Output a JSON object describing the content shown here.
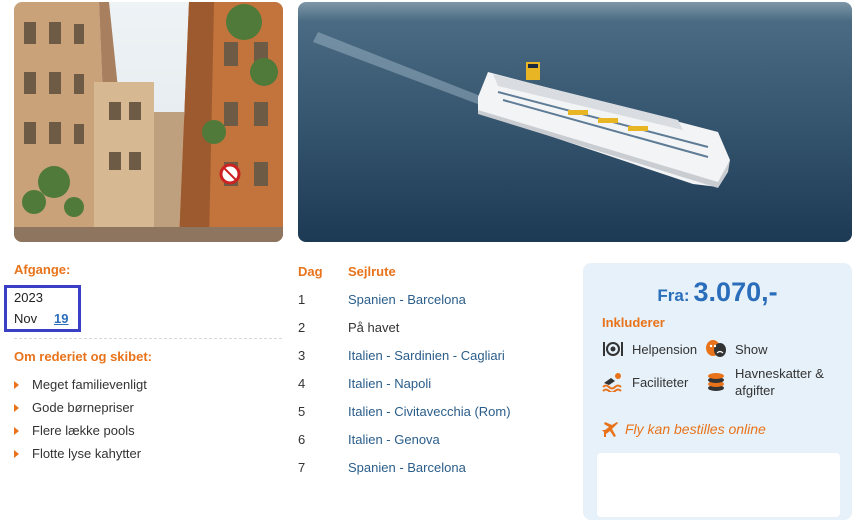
{
  "images": {
    "street": "street-photo",
    "ship": "cruise-ship-photo"
  },
  "departures": {
    "label": "Afgange:",
    "year": "2023",
    "month": "Nov",
    "day": "19"
  },
  "about": {
    "label": "Om rederiet og skibet:",
    "features": [
      "Meget familievenligt",
      "Gode børnepriser",
      "Flere lække pools",
      "Flotte lyse kahytter"
    ]
  },
  "itinerary": {
    "day_header": "Dag",
    "route_header": "Sejlrute",
    "rows": [
      {
        "day": "1",
        "place": "Spanien - Barcelona"
      },
      {
        "day": "2",
        "place": "På havet"
      },
      {
        "day": "3",
        "place": "Italien - Sardinien - Cagliari"
      },
      {
        "day": "4",
        "place": "Italien - Napoli"
      },
      {
        "day": "5",
        "place": "Italien - Civitavecchia (Rom)"
      },
      {
        "day": "6",
        "place": "Italien - Genova"
      },
      {
        "day": "7",
        "place": "Spanien - Barcelona"
      }
    ]
  },
  "price_card": {
    "from_label": "Fra:",
    "price": "3.070,-",
    "includes_label": "Inkluderer",
    "items": [
      {
        "icon": "dining-icon",
        "label": "Helpension"
      },
      {
        "icon": "theater-masks-icon",
        "label": "Show"
      },
      {
        "icon": "swimmer-icon",
        "label": "Faciliteter"
      },
      {
        "icon": "coins-icon",
        "label": "Havneskatter & afgifter"
      }
    ],
    "flight_note": "Fly kan bestilles online"
  },
  "colors": {
    "accent_orange": "#e8731a",
    "link_blue": "#2a6ebb",
    "card_bg": "#e6f1fa",
    "highlight_box": "#3a3fc6"
  }
}
